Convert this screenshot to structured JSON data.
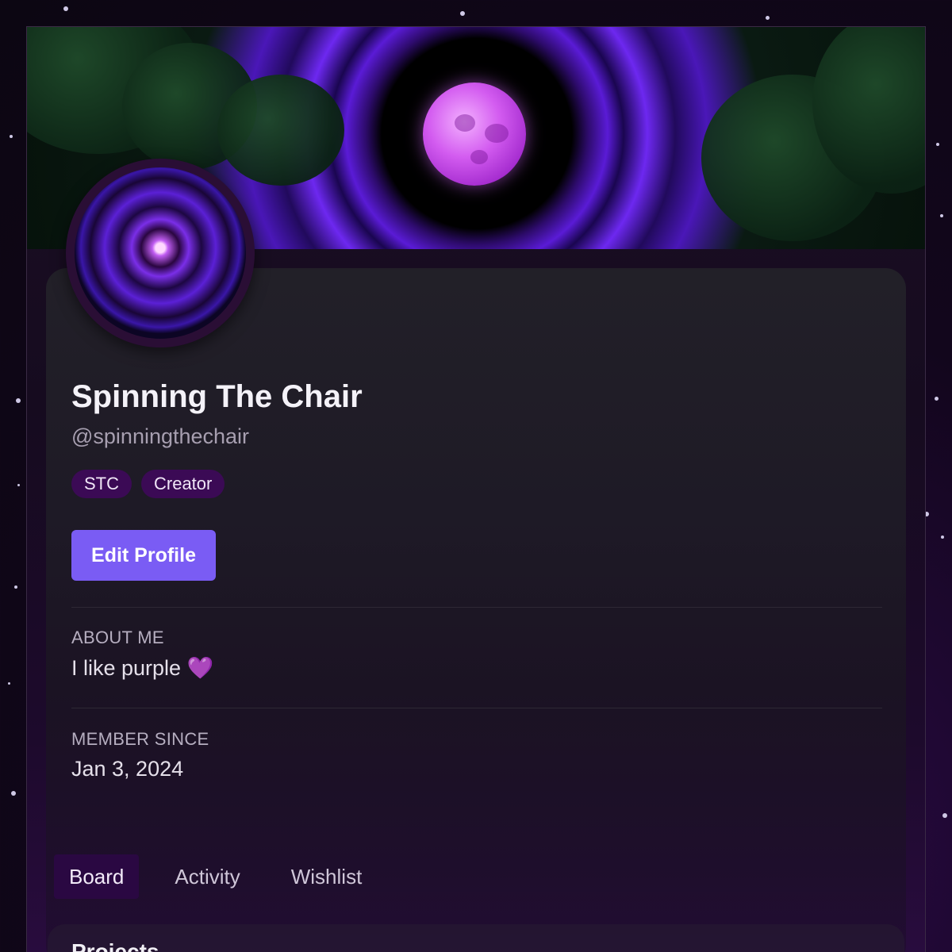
{
  "profile": {
    "display_name": "Spinning The Chair",
    "handle": "@spinningthechair",
    "tags": [
      "STC",
      "Creator"
    ],
    "edit_label": "Edit Profile"
  },
  "about": {
    "label": "ABOUT ME",
    "text": "I like purple 💜"
  },
  "member": {
    "label": "MEMBER SINCE",
    "date": "Jan 3, 2024"
  },
  "tabs": [
    {
      "label": "Board",
      "active": true
    },
    {
      "label": "Activity",
      "active": false
    },
    {
      "label": "Wishlist",
      "active": false
    }
  ],
  "board": {
    "section_title": "Projects"
  },
  "colors": {
    "accent": "#7a5cf4",
    "tag_bg": "#3b0a55",
    "background": "#12061c"
  },
  "icons": {
    "banner": "purple-moon-vortex-image",
    "avatar": "purple-swirl-avatar-image"
  }
}
